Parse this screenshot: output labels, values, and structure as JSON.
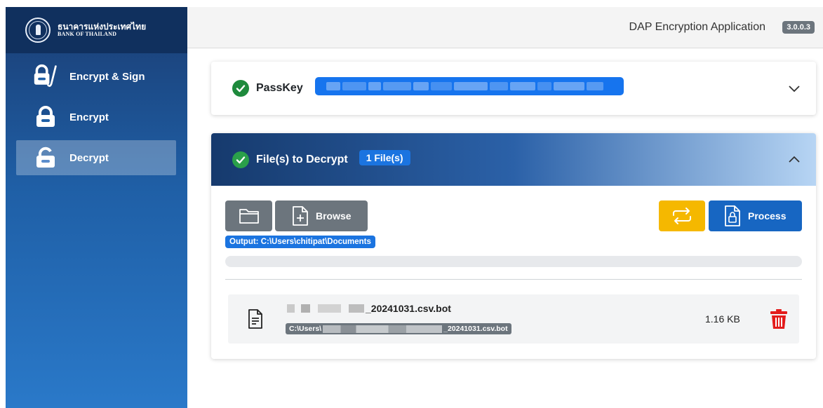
{
  "brand": {
    "name_th": "ธนาคารแห่งประเทศไทย",
    "name_en": "BANK OF THAILAND"
  },
  "sidebar": {
    "items": [
      {
        "label": "Encrypt & Sign",
        "icon": "lock-sign-icon",
        "active": false
      },
      {
        "label": "Encrypt",
        "icon": "lock-icon",
        "active": false
      },
      {
        "label": "Decrypt",
        "icon": "unlock-icon",
        "active": true
      }
    ]
  },
  "header": {
    "app_title": "DAP Encryption Application",
    "version": "3.0.0.3"
  },
  "passkey": {
    "label": "PassKey",
    "status": "check-circle-icon",
    "value_hidden": true
  },
  "files_section": {
    "title": "File(s) to Decrypt",
    "count_badge": "1 File(s)",
    "browse_label": "Browse",
    "process_label": "Process",
    "output_label": "Output: C:\\Users\\chitipat\\Documents",
    "progress": 0
  },
  "files": [
    {
      "name_suffix": "_20241031.csv.bot",
      "path_prefix": "C:\\Users\\",
      "path_suffix": "_20241031.csv.bot",
      "size": "1.16 KB"
    }
  ],
  "colors": {
    "primary": "#1766c2",
    "badge": "#1b74e0",
    "success": "#1e8a3c",
    "warning": "#f5b800",
    "danger": "#e31b1b",
    "secondary": "#6c757d"
  }
}
